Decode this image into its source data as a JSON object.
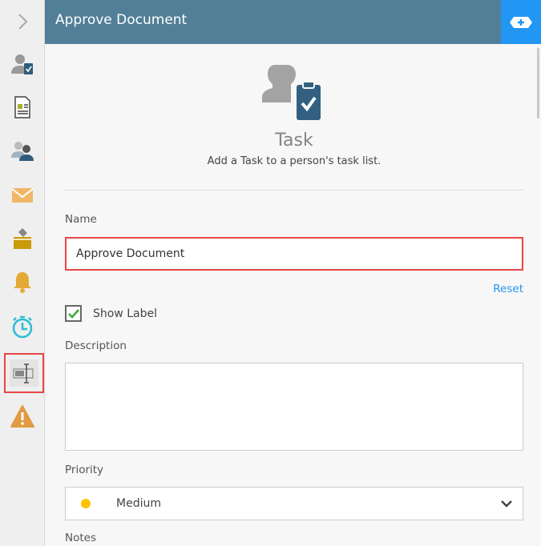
{
  "header": {
    "title": "Approve Document",
    "add_icon": "plus-badge-icon"
  },
  "sidebar": {
    "items": [
      "chevron-right-icon",
      "task-icon",
      "document-icon",
      "users-icon",
      "email-icon",
      "ballot-box-icon",
      "bell-icon",
      "timer-icon",
      "text-field-icon",
      "warning-icon"
    ],
    "selected": "text-field-icon"
  },
  "form": {
    "type_title": "Task",
    "type_description": "Add a Task to a person's task list.",
    "name_label": "Name",
    "name_value": "Approve Document",
    "reset_label": "Reset",
    "show_label": "Show Label",
    "show_label_checked": true,
    "description_label": "Description",
    "description_value": "",
    "priority_label": "Priority",
    "priority_value": "Medium",
    "priority_color": "#fdc300",
    "notes_label": "Notes"
  },
  "colors": {
    "header": "#527f98",
    "accent": "#2196f3",
    "highlight": "#e84545"
  }
}
